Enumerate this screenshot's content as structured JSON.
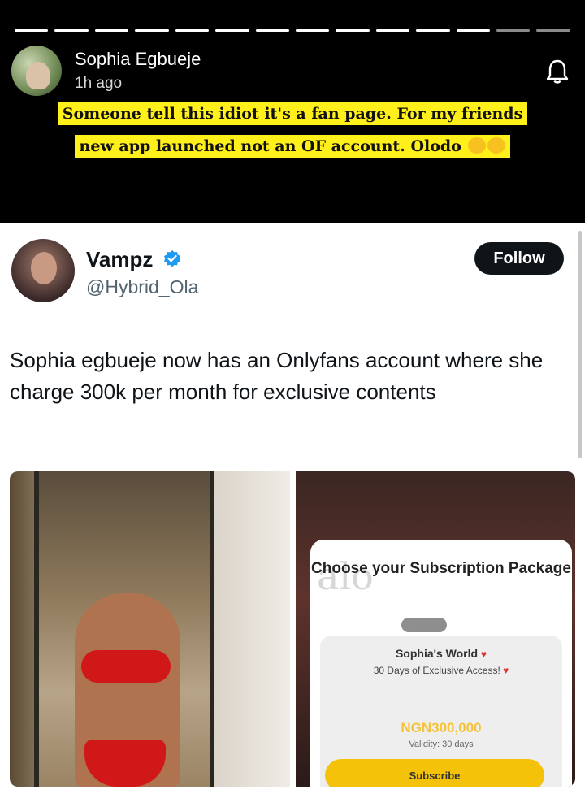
{
  "story": {
    "user_name": "Sophia Egbueje",
    "time": "1h ago",
    "caption_line1": "Someone tell this idiot it's a fan page. For my friends",
    "caption_line2": "new app launched not an OF account. Olodo",
    "progress_segments_total": 14,
    "progress_segments_viewed": 12
  },
  "tweet": {
    "display_name": "Vampz",
    "handle": "@Hybrid_Ola",
    "follow_label": "Follow",
    "text": "Sophia egbueje now has an Onlyfans account where she charge 300k per month for exclusive contents",
    "verified": true
  },
  "subscription_card": {
    "title": "Choose your Subscription Package",
    "package_name": "Sophia's World",
    "package_desc": "30 Days of Exclusive Access!",
    "price": "NGN300,000",
    "validity": "Validity: 30 days",
    "subscribe_label": "Subscribe"
  },
  "colors": {
    "caption_highlight": "#ffef1a",
    "follow_bg": "#0f1419",
    "verified_blue": "#1d9bf0",
    "subscribe_yellow": "#f5c20a"
  }
}
